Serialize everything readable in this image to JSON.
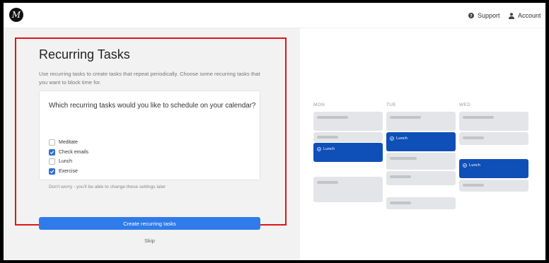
{
  "header": {
    "logo_letter": "M",
    "support_label": "Support",
    "account_label": "Account"
  },
  "main": {
    "title": "Recurring Tasks",
    "description": "Use recurring tasks to create tasks that repeat periodically. Choose some recurring tasks that you want to block time for.",
    "question": "Which recurring tasks would you like to schedule on your calendar?",
    "options": [
      {
        "label": "Meditate",
        "checked": false
      },
      {
        "label": "Check emails",
        "checked": true
      },
      {
        "label": "Lunch",
        "checked": false
      },
      {
        "label": "Exercise",
        "checked": true
      }
    ],
    "note": "Don't worry - you'll be able to change these settings later",
    "create_label": "Create recurring tasks",
    "skip_label": "Skip"
  },
  "preview": {
    "days": [
      "MON",
      "TUE",
      "WED"
    ],
    "event_label": "Lunch"
  },
  "colors": {
    "accent": "#2f7bea",
    "event": "#0f4fb8",
    "highlight": "#e01515"
  }
}
